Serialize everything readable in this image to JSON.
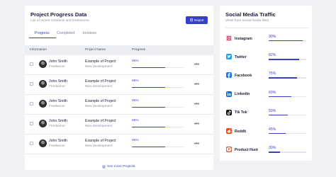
{
  "project_card": {
    "title": "Project Progress Data",
    "subtitle": "List of recent contracts and freelancers",
    "report_label": "Report",
    "tabs": [
      {
        "label": "Progress",
        "active": true
      },
      {
        "label": "Completed",
        "active": false
      },
      {
        "label": "Invoices",
        "active": false
      }
    ],
    "columns": [
      "Information",
      "Project Name",
      "Progress"
    ],
    "rows": [
      {
        "name": "John Smith",
        "role": "Freelancer",
        "project": "Example of Project",
        "stage": "New development",
        "progress_label": "65%",
        "progress": 0.65
      },
      {
        "name": "John Smith",
        "role": "Freelancer",
        "project": "Example of Project",
        "stage": "New development",
        "progress_label": "65%",
        "progress": 0.65
      },
      {
        "name": "John Smith",
        "role": "Freelancer",
        "project": "Example of Project",
        "stage": "New development",
        "progress_label": "65%",
        "progress": 0.65
      },
      {
        "name": "John Smith",
        "role": "Freelancer",
        "project": "Example of Project",
        "stage": "New development",
        "progress_label": "65%",
        "progress": 0.65
      },
      {
        "name": "John Smith",
        "role": "Freelancer",
        "project": "Example of Project",
        "stage": "New development",
        "progress_label": "65%",
        "progress": 0.65
      }
    ],
    "more_icon": "ellipsis-icon",
    "see_more_label": "See more Projects"
  },
  "traffic_card": {
    "title": "Social Media Traffic",
    "subtitle": "Visits from social media links",
    "items": [
      {
        "name": "Instagram",
        "percent_label": "90%",
        "percent": 0.9,
        "icon": "instagram-icon",
        "color": "#e4405f"
      },
      {
        "name": "Twitter",
        "percent_label": "82%",
        "percent": 0.82,
        "icon": "twitter-icon",
        "color": "#1da1f2"
      },
      {
        "name": "Facebook",
        "percent_label": "75%",
        "percent": 0.75,
        "icon": "facebook-icon",
        "color": "#1877f2"
      },
      {
        "name": "Linkedin",
        "percent_label": "60%",
        "percent": 0.6,
        "icon": "linkedin-icon",
        "color": "#0a66c2"
      },
      {
        "name": "Tik Tok",
        "percent_label": "50%",
        "percent": 0.5,
        "icon": "tiktok-icon",
        "color": "#111111"
      },
      {
        "name": "Reddit",
        "percent_label": "45%",
        "percent": 0.45,
        "icon": "reddit-icon",
        "color": "#ff4500"
      },
      {
        "name": "Product Hunt",
        "percent_label": "30%",
        "percent": 0.3,
        "icon": "product-hunt-icon",
        "color": "#da552f"
      }
    ]
  },
  "colors": {
    "accent": "#3a3fc9",
    "background": "#f1f2f6"
  }
}
